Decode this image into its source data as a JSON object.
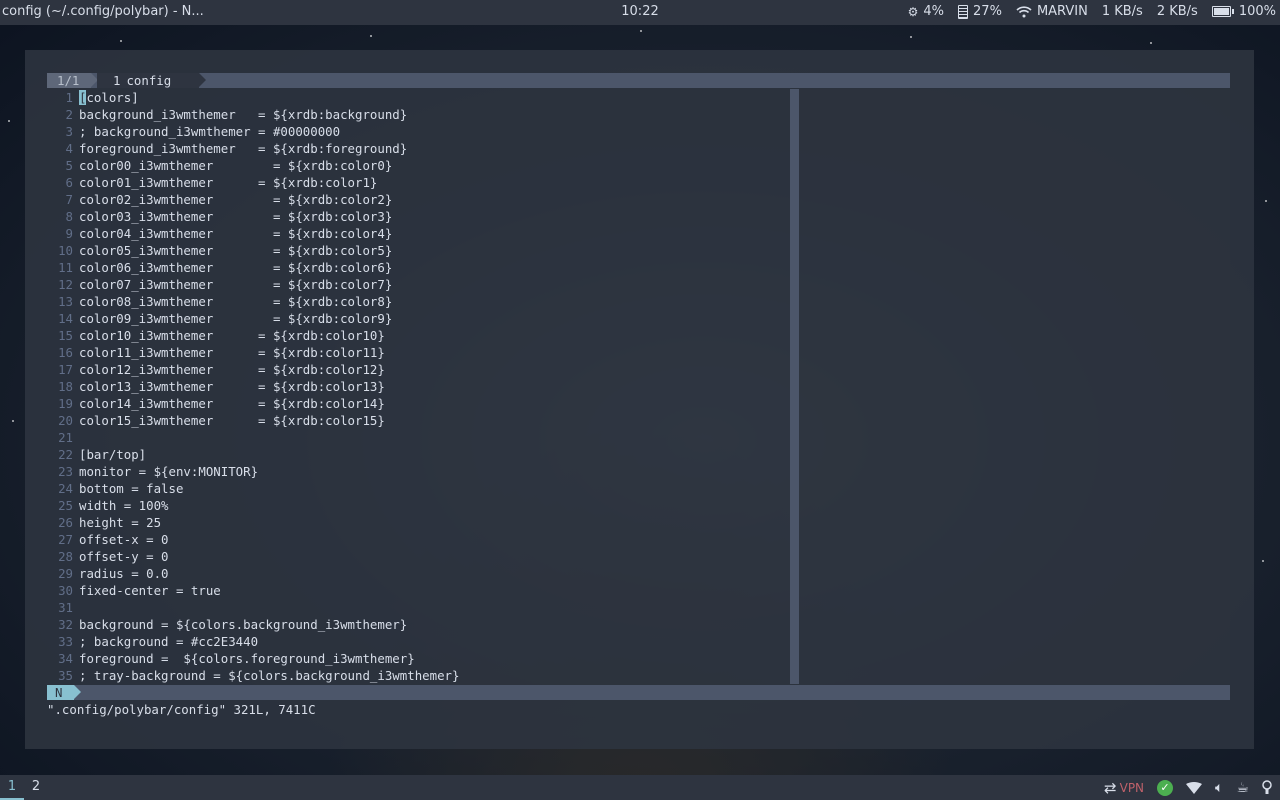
{
  "topbar": {
    "window_title": "config (~/.config/polybar) - N...",
    "clock": "10:22",
    "cpu": "4%",
    "memory": "27%",
    "wifi": "MARVIN",
    "download": "1 KB/s",
    "upload": "2 KB/s",
    "battery": "100%"
  },
  "editor": {
    "tab_position": "1/1",
    "tab_number": "1",
    "tab_name": "config",
    "mode": "N",
    "message": "\".config/polybar/config\" 321L, 7411C",
    "lines": [
      {
        "n": "1",
        "t": "colors]",
        "cursor": "["
      },
      {
        "n": "2",
        "t": "background_i3wmthemer   = ${xrdb:background}"
      },
      {
        "n": "3",
        "t": "; background_i3wmthemer = #00000000"
      },
      {
        "n": "4",
        "t": "foreground_i3wmthemer   = ${xrdb:foreground}"
      },
      {
        "n": "5",
        "t": "color00_i3wmthemer        = ${xrdb:color0}"
      },
      {
        "n": "6",
        "t": "color01_i3wmthemer      = ${xrdb:color1}"
      },
      {
        "n": "7",
        "t": "color02_i3wmthemer        = ${xrdb:color2}"
      },
      {
        "n": "8",
        "t": "color03_i3wmthemer        = ${xrdb:color3}"
      },
      {
        "n": "9",
        "t": "color04_i3wmthemer        = ${xrdb:color4}"
      },
      {
        "n": "10",
        "t": "color05_i3wmthemer        = ${xrdb:color5}"
      },
      {
        "n": "11",
        "t": "color06_i3wmthemer        = ${xrdb:color6}"
      },
      {
        "n": "12",
        "t": "color07_i3wmthemer        = ${xrdb:color7}"
      },
      {
        "n": "13",
        "t": "color08_i3wmthemer        = ${xrdb:color8}"
      },
      {
        "n": "14",
        "t": "color09_i3wmthemer        = ${xrdb:color9}"
      },
      {
        "n": "15",
        "t": "color10_i3wmthemer      = ${xrdb:color10}"
      },
      {
        "n": "16",
        "t": "color11_i3wmthemer      = ${xrdb:color11}"
      },
      {
        "n": "17",
        "t": "color12_i3wmthemer      = ${xrdb:color12}"
      },
      {
        "n": "18",
        "t": "color13_i3wmthemer      = ${xrdb:color13}"
      },
      {
        "n": "19",
        "t": "color14_i3wmthemer      = ${xrdb:color14}"
      },
      {
        "n": "20",
        "t": "color15_i3wmthemer      = ${xrdb:color15}"
      },
      {
        "n": "21",
        "t": ""
      },
      {
        "n": "22",
        "t": "[bar/top]"
      },
      {
        "n": "23",
        "t": "monitor = ${env:MONITOR}"
      },
      {
        "n": "24",
        "t": "bottom = false"
      },
      {
        "n": "25",
        "t": "width = 100%"
      },
      {
        "n": "26",
        "t": "height = 25"
      },
      {
        "n": "27",
        "t": "offset-x = 0"
      },
      {
        "n": "28",
        "t": "offset-y = 0"
      },
      {
        "n": "29",
        "t": "radius = 0.0"
      },
      {
        "n": "30",
        "t": "fixed-center = true"
      },
      {
        "n": "31",
        "t": ""
      },
      {
        "n": "32",
        "t": "background = ${colors.background_i3wmthemer}"
      },
      {
        "n": "33",
        "t": "; background = #cc2E3440"
      },
      {
        "n": "34",
        "t": "foreground =  ${colors.foreground_i3wmthemer}"
      },
      {
        "n": "35",
        "t": "; tray-background = ${colors.background_i3wmthemer}"
      }
    ]
  },
  "bottombar": {
    "workspaces": [
      "1",
      "2"
    ],
    "vpn_label": "VPN"
  },
  "colors": {
    "bar_bg": "#2e3440",
    "accent": "#88c0d0",
    "vpn": "#bf616a",
    "check": "#4caf50"
  }
}
